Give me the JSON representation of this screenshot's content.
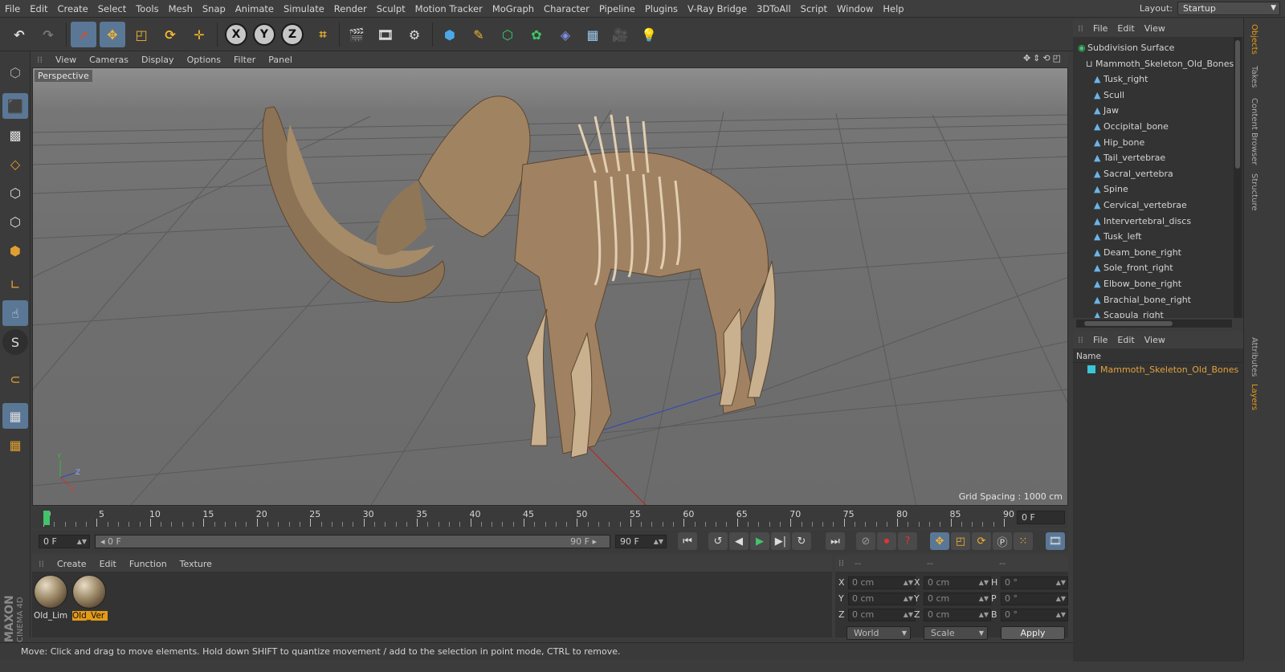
{
  "menu": [
    "File",
    "Edit",
    "Create",
    "Select",
    "Tools",
    "Mesh",
    "Snap",
    "Animate",
    "Simulate",
    "Render",
    "Sculpt",
    "Motion Tracker",
    "MoGraph",
    "Character",
    "Pipeline",
    "Plugins",
    "V-Ray Bridge",
    "3DToAll",
    "Script",
    "Window",
    "Help"
  ],
  "layout": {
    "label": "Layout:",
    "value": "Startup"
  },
  "toolbar_axes": [
    "X",
    "Y",
    "Z"
  ],
  "viewport": {
    "menu": [
      "View",
      "Cameras",
      "Display",
      "Options",
      "Filter",
      "Panel"
    ],
    "label": "Perspective",
    "grid_spacing": "Grid Spacing : 1000 cm",
    "nav_icons": "✥⇕⟲◰"
  },
  "timeline": {
    "ticks": [
      "0",
      "5",
      "10",
      "15",
      "20",
      "25",
      "30",
      "35",
      "40",
      "45",
      "50",
      "55",
      "60",
      "65",
      "70",
      "75",
      "80",
      "85",
      "90"
    ],
    "end_field": "0 F"
  },
  "transport": {
    "start": "0 F",
    "range_left": "◂ 0 F",
    "range_right": "90 F ▸",
    "end": "90 F"
  },
  "materials": {
    "menu": [
      "Create",
      "Edit",
      "Function",
      "Texture"
    ],
    "items": [
      {
        "name": "Old_Lim",
        "selected": false
      },
      {
        "name": "Old_Ver",
        "selected": true
      }
    ]
  },
  "coords": {
    "header_dashes": [
      "--",
      "--",
      "--"
    ],
    "rows": [
      {
        "a": "X",
        "av": "0 cm",
        "b": "X",
        "bv": "0 cm",
        "c": "H",
        "cv": "0 °"
      },
      {
        "a": "Y",
        "av": "0 cm",
        "b": "Y",
        "bv": "0 cm",
        "c": "P",
        "cv": "0 °"
      },
      {
        "a": "Z",
        "av": "0 cm",
        "b": "Z",
        "bv": "0 cm",
        "c": "B",
        "cv": "0 °"
      }
    ],
    "world": "World",
    "scale": "Scale",
    "apply": "Apply"
  },
  "status": "Move: Click and drag to move elements. Hold down SHIFT to quantize movement / add to the selection in point mode, CTRL to remove.",
  "objects": {
    "menu": [
      "File",
      "Edit",
      "View"
    ],
    "items": [
      {
        "name": "Subdivision Surface",
        "depth": 0
      },
      {
        "name": "Mammoth_Skeleton_Old_Bones",
        "depth": 1
      },
      {
        "name": "Tusk_right",
        "depth": 2
      },
      {
        "name": "Scull",
        "depth": 2
      },
      {
        "name": "Jaw",
        "depth": 2
      },
      {
        "name": "Occipital_bone",
        "depth": 2
      },
      {
        "name": "Hip_bone",
        "depth": 2
      },
      {
        "name": "Tail_vertebrae",
        "depth": 2
      },
      {
        "name": "Sacral_vertebra",
        "depth": 2
      },
      {
        "name": "Spine",
        "depth": 2
      },
      {
        "name": "Cervical_vertebrae",
        "depth": 2
      },
      {
        "name": "Intervertebral_discs",
        "depth": 2
      },
      {
        "name": "Tusk_left",
        "depth": 2
      },
      {
        "name": "Deam_bone_right",
        "depth": 2
      },
      {
        "name": "Sole_front_right",
        "depth": 2
      },
      {
        "name": "Elbow_bone_right",
        "depth": 2
      },
      {
        "name": "Brachial_bone_right",
        "depth": 2
      },
      {
        "name": "Scapula_right",
        "depth": 2
      }
    ]
  },
  "layers": {
    "menu": [
      "File",
      "Edit",
      "View"
    ],
    "col_name": "Name",
    "row": "Mammoth_Skeleton_Old_Bones"
  },
  "right_tabs": [
    "Objects",
    "Takes",
    "Content Browser",
    "Structure",
    "Attributes",
    "Layers"
  ],
  "brand": {
    "a": "MAXON",
    "b": "CINEMA 4D"
  },
  "colors": {
    "accent": "#5a7796",
    "selected": "#e39a19",
    "playhead": "#42c46b",
    "layer": "#39c6d8"
  }
}
